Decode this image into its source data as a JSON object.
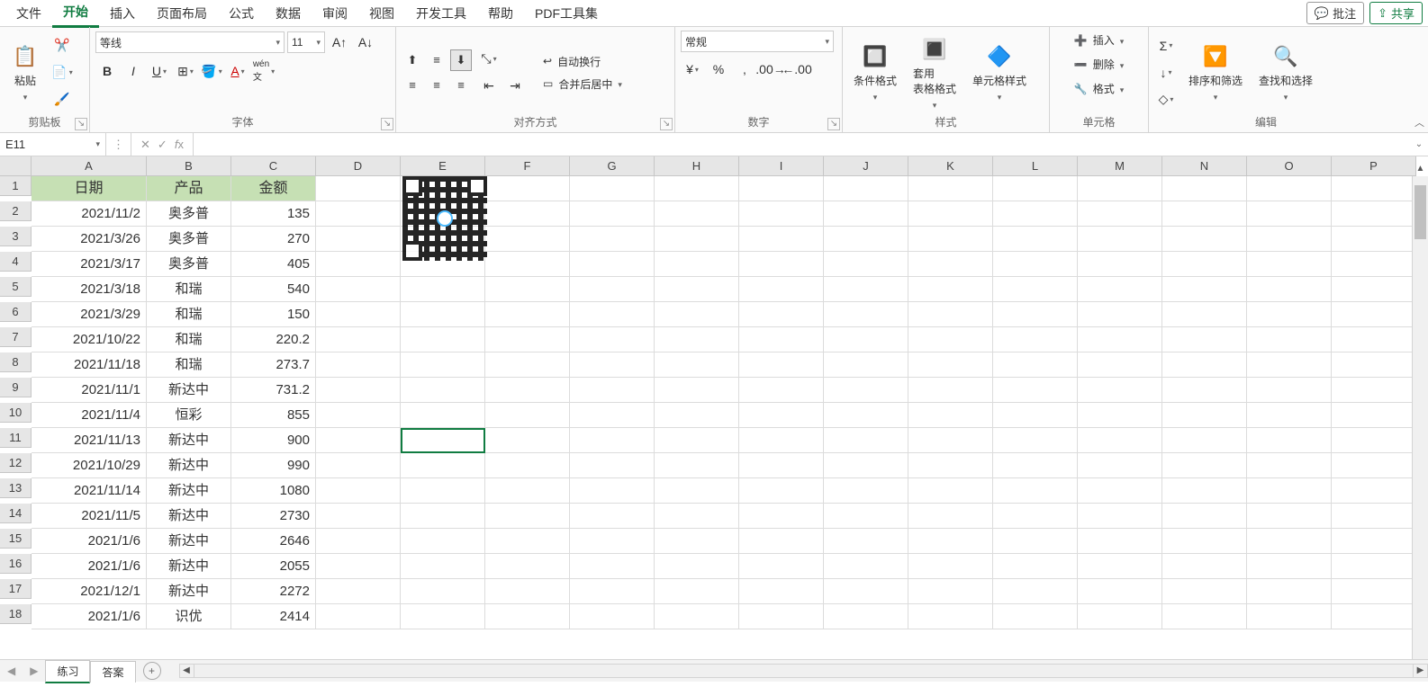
{
  "menu": {
    "items": [
      "文件",
      "开始",
      "插入",
      "页面布局",
      "公式",
      "数据",
      "审阅",
      "视图",
      "开发工具",
      "帮助",
      "PDF工具集"
    ],
    "active_index": 1
  },
  "topright": {
    "comment": "批注",
    "share": "共享"
  },
  "ribbon": {
    "clipboard": {
      "paste": "粘贴",
      "label": "剪贴板"
    },
    "font": {
      "name": "等线",
      "size": "11",
      "label": "字体"
    },
    "alignment": {
      "wrap": "自动换行",
      "merge": "合并后居中",
      "label": "对齐方式"
    },
    "number": {
      "format": "常规",
      "label": "数字"
    },
    "styles": {
      "conditional": "条件格式",
      "tablefmt": "套用\n表格格式",
      "cellstyle": "单元格样式",
      "label": "样式"
    },
    "cells": {
      "insert": "插入",
      "delete": "删除",
      "format": "格式",
      "label": "单元格"
    },
    "editing": {
      "sortfilter": "排序和筛选",
      "findselect": "查找和选择",
      "label": "编辑"
    }
  },
  "namebox": "E11",
  "formula": "",
  "columns": [
    "A",
    "B",
    "C",
    "D",
    "E",
    "F",
    "G",
    "H",
    "I",
    "J",
    "K",
    "L",
    "M",
    "N",
    "O",
    "P"
  ],
  "rows": [
    1,
    2,
    3,
    4,
    5,
    6,
    7,
    8,
    9,
    10,
    11,
    12,
    13,
    14,
    15,
    16,
    17,
    18
  ],
  "table": {
    "headers": [
      "日期",
      "产品",
      "金额"
    ],
    "data": [
      [
        "2021/11/2",
        "奥多普",
        "135"
      ],
      [
        "2021/3/26",
        "奥多普",
        "270"
      ],
      [
        "2021/3/17",
        "奥多普",
        "405"
      ],
      [
        "2021/3/18",
        "和瑞",
        "540"
      ],
      [
        "2021/3/29",
        "和瑞",
        "150"
      ],
      [
        "2021/10/22",
        "和瑞",
        "220.2"
      ],
      [
        "2021/11/18",
        "和瑞",
        "273.7"
      ],
      [
        "2021/11/1",
        "新达中",
        "731.2"
      ],
      [
        "2021/11/4",
        "恒彩",
        "855"
      ],
      [
        "2021/11/13",
        "新达中",
        "900"
      ],
      [
        "2021/10/29",
        "新达中",
        "990"
      ],
      [
        "2021/11/14",
        "新达中",
        "1080"
      ],
      [
        "2021/11/5",
        "新达中",
        "2730"
      ],
      [
        "2021/1/6",
        "新达中",
        "2646"
      ],
      [
        "2021/1/6",
        "新达中",
        "2055"
      ],
      [
        "2021/12/1",
        "新达中",
        "2272"
      ],
      [
        "2021/1/6",
        "识优",
        "2414"
      ]
    ]
  },
  "selection": {
    "col": 4,
    "row": 11
  },
  "sheets": {
    "tabs": [
      "练习",
      "答案"
    ],
    "active_index": 0
  }
}
